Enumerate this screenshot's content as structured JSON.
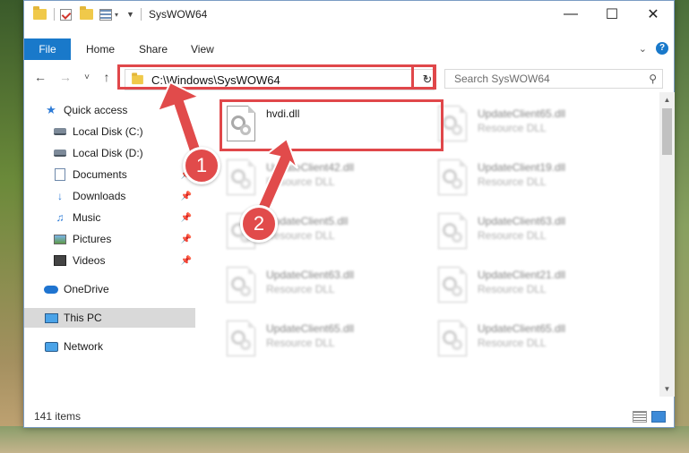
{
  "window": {
    "title": "SysWOW64",
    "minimize_glyph": "—",
    "maximize_glyph": "☐",
    "close_glyph": "✕"
  },
  "ribbon": {
    "tabs": [
      {
        "label": "File"
      },
      {
        "label": "Home"
      },
      {
        "label": "Share"
      },
      {
        "label": "View"
      }
    ],
    "help_glyph": "?"
  },
  "navigation": {
    "back_glyph": "←",
    "forward_glyph": "→",
    "recent_glyph": "˅",
    "up_glyph": "↑",
    "address_path": "C:\\Windows\\SysWOW64",
    "search_placeholder": "Search SysWOW64"
  },
  "sidebar": {
    "items": [
      {
        "label": "Quick access",
        "icon": "star-icon"
      },
      {
        "label": "Local Disk (C:)",
        "icon": "drive-icon"
      },
      {
        "label": "Local Disk (D:)",
        "icon": "drive-icon"
      },
      {
        "label": "Documents",
        "icon": "documents-icon"
      },
      {
        "label": "Downloads",
        "icon": "downloads-icon"
      },
      {
        "label": "Music",
        "icon": "music-icon"
      },
      {
        "label": "Pictures",
        "icon": "pictures-icon"
      },
      {
        "label": "Videos",
        "icon": "videos-icon"
      },
      {
        "label": "OneDrive",
        "icon": "cloud-icon"
      },
      {
        "label": "This PC",
        "icon": "computer-icon"
      },
      {
        "label": "Network",
        "icon": "network-icon"
      }
    ]
  },
  "files": [
    {
      "name": "hvdi.dll",
      "type": ""
    },
    {
      "name": "UpdateClient65.dll",
      "type": "Resource DLL"
    },
    {
      "name": "UpdateClient42.dll",
      "type": "Resource DLL"
    },
    {
      "name": "UpdateClient19.dll",
      "type": "Resource DLL"
    },
    {
      "name": "UpdateClient5.dll",
      "type": "Resource DLL"
    },
    {
      "name": "UpdateClient63.dll",
      "type": "Resource DLL"
    },
    {
      "name": "UpdateClient63.dll",
      "type": "Resource DLL"
    },
    {
      "name": "UpdateClient21.dll",
      "type": "Resource DLL"
    },
    {
      "name": "UpdateClient65.dll",
      "type": "Resource DLL"
    },
    {
      "name": "UpdateClient65.dll",
      "type": "Resource DLL"
    }
  ],
  "status": {
    "item_count": "141 items"
  },
  "annotations": {
    "step1": "1",
    "step2": "2",
    "highlight_color": "#e0474a"
  }
}
